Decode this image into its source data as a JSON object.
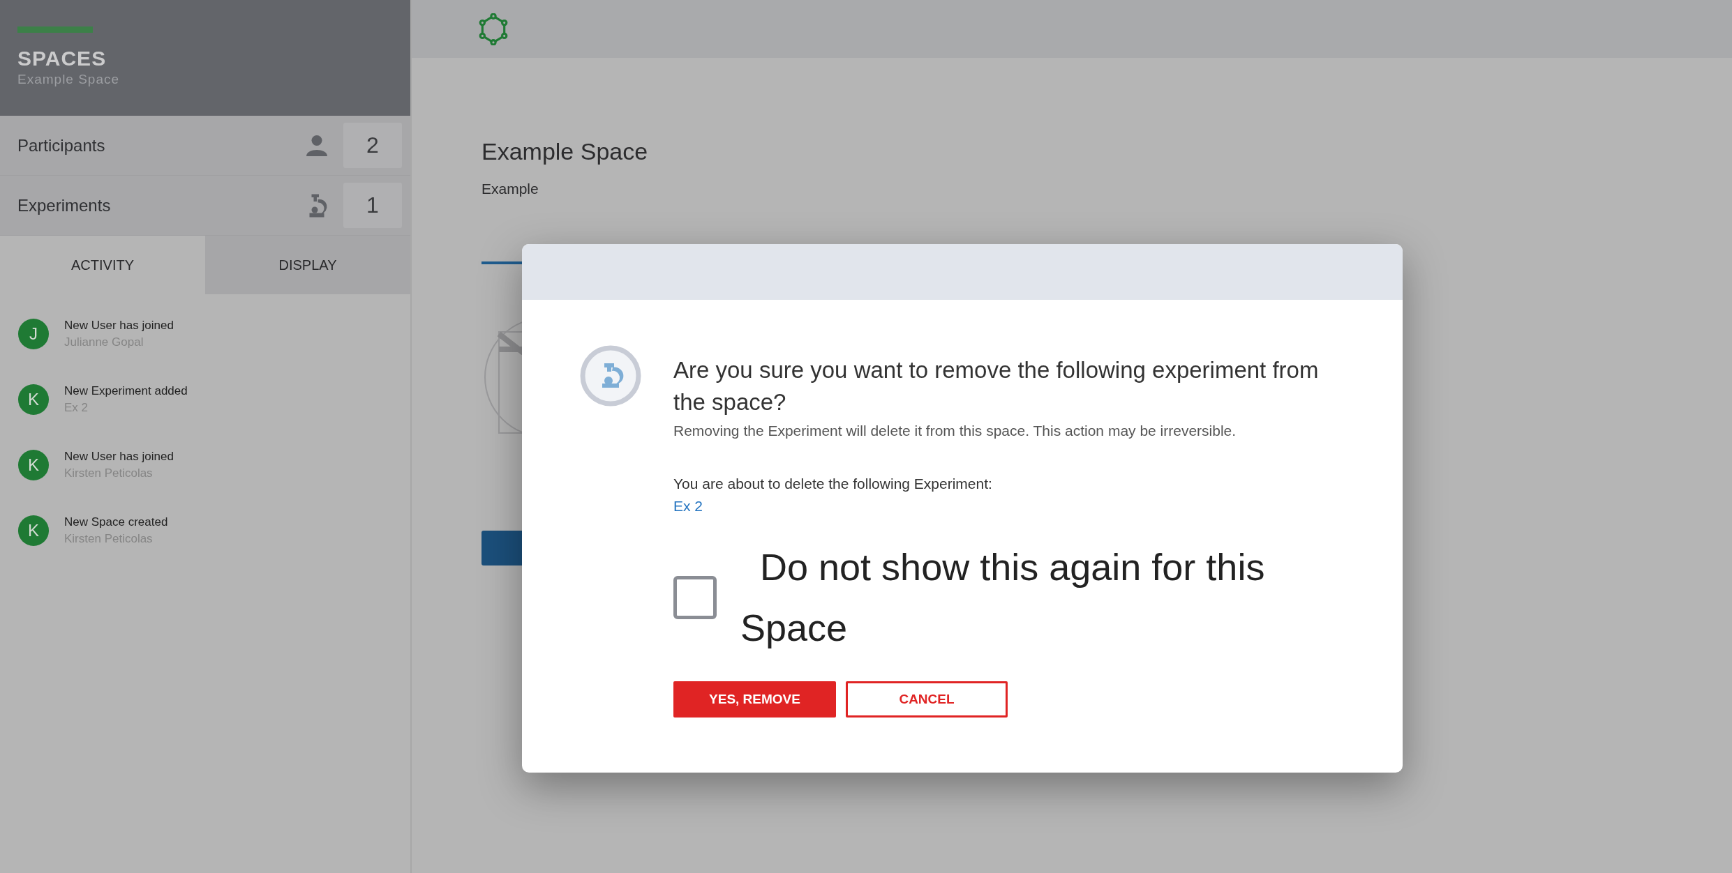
{
  "sidebar": {
    "title": "SPACES",
    "subtitle": "Example Space",
    "stats": [
      {
        "kind": "participants",
        "label": "Participants",
        "count": "2"
      },
      {
        "kind": "experiments",
        "label": "Experiments",
        "count": "1"
      }
    ],
    "tabs": [
      {
        "label": "ACTIVITY",
        "selected": true
      },
      {
        "label": "DISPLAY",
        "selected": false
      }
    ],
    "activity": [
      {
        "initial": "J",
        "title": "New User has joined",
        "detail": "Julianne Gopal"
      },
      {
        "initial": "K",
        "title": "New Experiment added",
        "detail": "Ex 2"
      },
      {
        "initial": "K",
        "title": "New User has joined",
        "detail": "Kirsten Peticolas"
      },
      {
        "initial": "K",
        "title": "New Space created",
        "detail": "Kirsten Peticolas"
      }
    ]
  },
  "main": {
    "title": "Example Space",
    "subtitle": "Example"
  },
  "dialog": {
    "question": "Are you sure you want to remove the following experiment from the space?",
    "warning": "Removing the Experiment will delete it from this space. This action may be irreversible.",
    "prompt": "You are about to delete the following Experiment:",
    "item": "Ex 2",
    "checkbox": {
      "label": "Do not show this again for this Space",
      "checked": false
    },
    "buttons": [
      {
        "kind": "primary",
        "label": "YES, REMOVE"
      },
      {
        "kind": "secondary",
        "label": "CANCEL"
      }
    ]
  }
}
